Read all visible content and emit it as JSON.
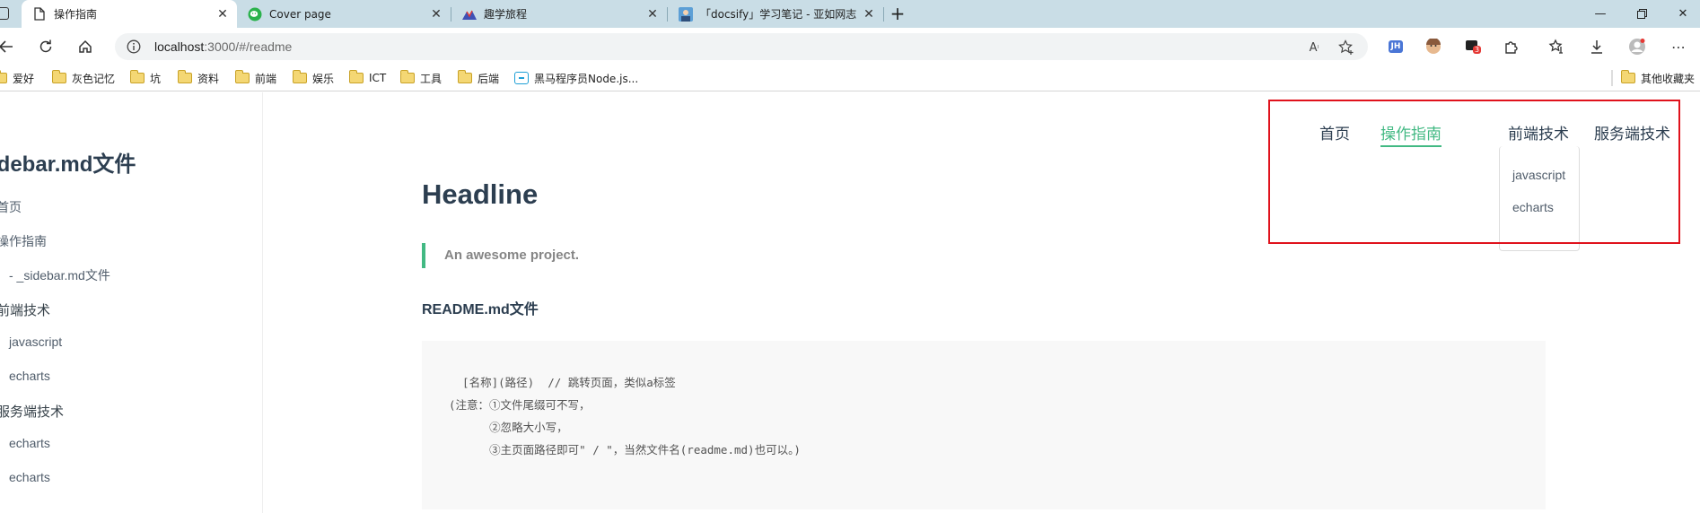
{
  "browser": {
    "tabs": [
      {
        "title": "操作指南",
        "favicon": "page-icon",
        "active": true
      },
      {
        "title": "Cover page",
        "favicon": "wechat-icon",
        "active": false
      },
      {
        "title": "趣学旅程",
        "favicon": "mountain-logo-icon",
        "active": false
      },
      {
        "title": "「docsify」学习笔记 - 亚如网志",
        "favicon": "avatar-icon",
        "active": false
      }
    ],
    "address": {
      "host": "localhost",
      "rest": ":3000/#/readme"
    },
    "bookmarks": [
      {
        "label": "爱好"
      },
      {
        "label": "灰色记忆"
      },
      {
        "label": "坑"
      },
      {
        "label": "资料"
      },
      {
        "label": "前端"
      },
      {
        "label": "娱乐"
      },
      {
        "label": "ICT"
      },
      {
        "label": "工具"
      },
      {
        "label": "后端"
      },
      {
        "label": "黑马程序员Node.js..."
      }
    ],
    "other_bookmarks": "其他收藏夹",
    "extension_badge": "3"
  },
  "sidebar": {
    "title": "idebar.md文件",
    "items": [
      {
        "label": "首页"
      },
      {
        "label": "操作指南"
      },
      {
        "label": "- _sidebar.md文件"
      },
      {
        "label": "前端技术"
      },
      {
        "label": "javascript"
      },
      {
        "label": "echarts"
      },
      {
        "label": "服务端技术"
      },
      {
        "label": "echarts"
      },
      {
        "label": "echarts"
      }
    ]
  },
  "topnav": {
    "items": [
      {
        "label": "首页"
      },
      {
        "label": "操作指南"
      },
      {
        "label": "前端技术"
      },
      {
        "label": "服务端技术"
      }
    ],
    "dropdown": [
      "javascript",
      "echarts"
    ]
  },
  "content": {
    "headline": "Headline",
    "quote": "An awesome project.",
    "subheading": "README.md文件",
    "code_lines": [
      "  [名称](路径)  // 跳转页面，类似a标签",
      "(注意：①文件尾缀可不写，",
      "      ②忽略大小写，",
      "      ③主页面路径即可\" / \"，当然文件名(readme.md)也可以。)"
    ]
  },
  "colors": {
    "accent": "#42b983",
    "highlight": "#e0121c",
    "tabbar": "#c9dde6"
  }
}
